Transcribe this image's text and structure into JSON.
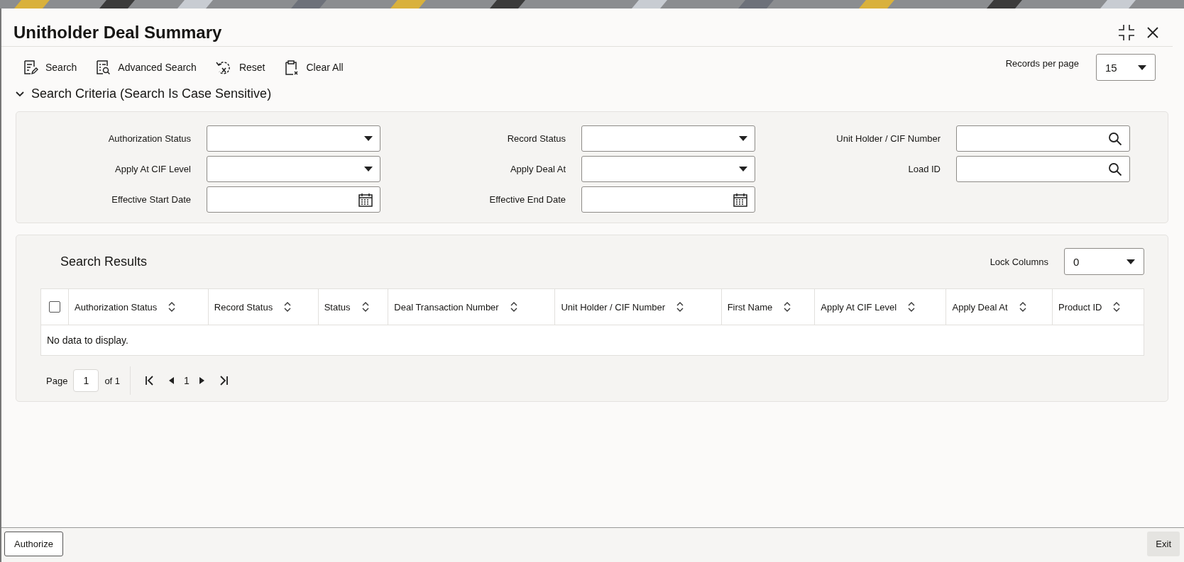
{
  "window": {
    "title": "Unitholder Deal Summary"
  },
  "toolbar": [
    {
      "label": "Search",
      "kind": "search"
    },
    {
      "label": "Advanced Search",
      "kind": "advanced"
    },
    {
      "label": "Reset",
      "kind": "reset"
    },
    {
      "label": "Clear All",
      "kind": "clear"
    }
  ],
  "records_per_page": {
    "label": "Records per page",
    "value": "15"
  },
  "criteria": {
    "title": "Search Criteria (Search Is Case Sensitive)",
    "expanded": true,
    "rows": [
      [
        {
          "label": "Authorization Status",
          "kind": "select"
        },
        {
          "label": "Record Status",
          "kind": "select"
        },
        {
          "label": "Unit Holder / CIF Number",
          "kind": "lookup"
        }
      ],
      [
        {
          "label": "Apply At CIF Level",
          "kind": "select"
        },
        {
          "label": "Apply Deal At",
          "kind": "select"
        },
        {
          "label": "Load ID",
          "kind": "lookup"
        }
      ],
      [
        {
          "label": "Effective Start Date",
          "kind": "date"
        },
        {
          "label": "Effective End Date",
          "kind": "date"
        }
      ]
    ]
  },
  "results": {
    "title": "Search Results",
    "lock_columns": {
      "label": "Lock Columns",
      "value": "0"
    },
    "select_all": {
      "checked": false
    },
    "columns": [
      "Authorization Status",
      "Record Status",
      "Status",
      "Deal Transaction Number",
      "Unit Holder / CIF Number",
      "First Name",
      "Apply At CIF Level",
      "Apply Deal At",
      "Product ID"
    ],
    "empty_message": "No data to display.",
    "pagination": {
      "label": "Page",
      "page": "1",
      "of": "of 1",
      "current": "1"
    }
  },
  "footer": {
    "left_button": "Authorize",
    "right_button": "Exit"
  }
}
